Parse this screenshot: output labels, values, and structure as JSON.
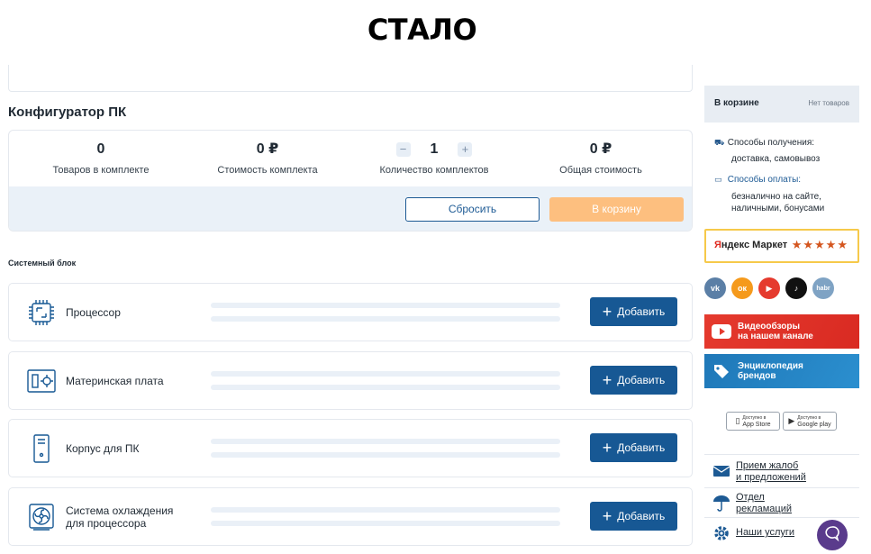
{
  "slide_title": "СТАЛО",
  "configurator": {
    "title": "Конфигуратор ПК",
    "stats": [
      {
        "value": "0",
        "label": "Товаров в комплекте"
      },
      {
        "value": "0 ₽",
        "label": "Стоимость комплекта"
      },
      {
        "value": "1",
        "label": "Количество комплектов"
      },
      {
        "value": "0 ₽",
        "label": "Общая стоимость"
      }
    ],
    "qty_minus": "−",
    "qty_plus": "+",
    "reset_label": "Сбросить",
    "cart_label": "В корзину",
    "section_label": "Системный блок",
    "add_label": "Добавить",
    "components": [
      {
        "name": "Процессор",
        "icon": "cpu-icon"
      },
      {
        "name": "Материнская плата",
        "icon": "motherboard-icon"
      },
      {
        "name": "Корпус для ПК",
        "icon": "pc-case-icon"
      },
      {
        "name": "Система охлаждения\nдля процессора",
        "icon": "cpu-cooler-icon"
      }
    ]
  },
  "sidebar": {
    "cart_title": "В корзине",
    "cart_status": "Нет товаров",
    "delivery_label": "Способы получения:",
    "delivery_value": "доставка, самовывоз",
    "payment_label": "Способы оплаты:",
    "payment_value": "безналично на сайте,\nналичными, бонусами",
    "market_name_a": "Я",
    "market_name_b": "ндекс Маркет",
    "market_stars": "★★★★★",
    "socials": [
      {
        "name": "vk",
        "text": "vk",
        "color": "#5b7fa6"
      },
      {
        "name": "ok",
        "text": "ок",
        "color": "#f59a1c"
      },
      {
        "name": "youtube",
        "text": "▶",
        "color": "#e53a2e"
      },
      {
        "name": "tiktok",
        "text": "♪",
        "color": "#111111"
      },
      {
        "name": "habr",
        "text": "habr",
        "color": "#7fa3c4"
      }
    ],
    "video_banner": "Видеообзоры\nна нашем канале",
    "brands_banner": "Энциклопедия\nбрендов",
    "app_store_small": "Доступно в",
    "app_store": "App Store",
    "google_play_small": "Доступно в",
    "google_play": "Google play",
    "links": [
      {
        "text": "Прием жалоб\nи предложений",
        "icon": "mail-icon"
      },
      {
        "text": "Отдел\nрекламаций",
        "icon": "umbrella-icon"
      },
      {
        "text": "Наши услуги",
        "icon": "gear-icon"
      }
    ],
    "colors": {
      "primary": "#175894",
      "cart_disabled": "#fdbf7f",
      "video_red": "#e53a2e",
      "brands_blue": "#1f78b8"
    }
  }
}
